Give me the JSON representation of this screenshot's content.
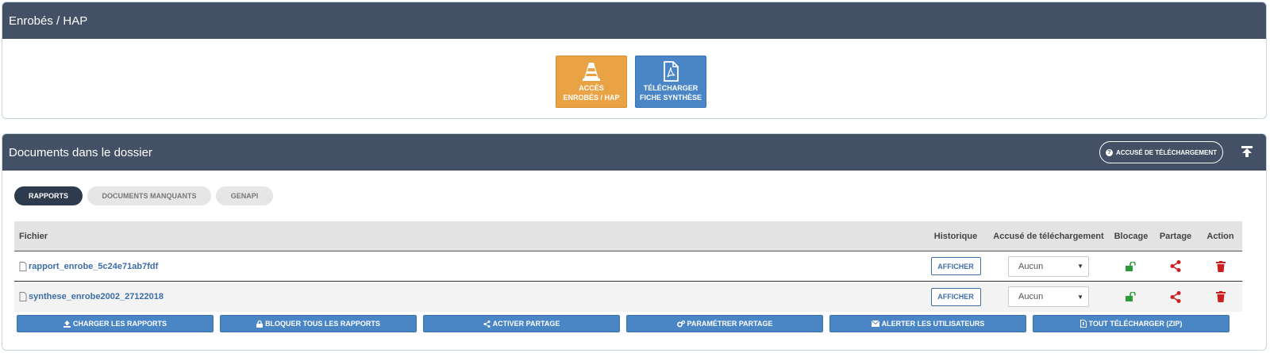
{
  "top_panel": {
    "title": "Enrobés / HAP",
    "tiles": [
      {
        "line1": "Accès",
        "line2": "enrobés / HAP",
        "icon": "traffic-cone-icon",
        "color": "#e9a345"
      },
      {
        "line1": "Télécharger",
        "line2": "fiche synthèse",
        "icon": "pdf-file-icon",
        "color": "#4a86c6"
      }
    ]
  },
  "docs_panel": {
    "title": "Documents dans le dossier",
    "accuse_button": "Accusé de téléchargement",
    "tabs": [
      {
        "label": "Rapports",
        "active": true
      },
      {
        "label": "Documents manquants",
        "active": false
      },
      {
        "label": "GENAPI",
        "active": false
      }
    ],
    "table": {
      "headers": [
        "Fichier",
        "Historique",
        "Accusé de téléchargement",
        "Blocage",
        "Partage",
        "Action"
      ],
      "rows": [
        {
          "file": "rapport_enrobe_5c24e71ab7fdf",
          "history_button": "Afficher",
          "accuse": "Aucun",
          "blocage_icon": "unlock-icon",
          "partage_icon": "share-icon",
          "action_icon": "trash-icon"
        },
        {
          "file": "synthese_enrobe2002_27122018",
          "history_button": "Afficher",
          "accuse": "Aucun",
          "blocage_icon": "unlock-icon",
          "partage_icon": "share-icon",
          "action_icon": "trash-icon"
        }
      ]
    },
    "action_buttons": [
      {
        "label": "Charger les rapports",
        "icon": "upload-icon"
      },
      {
        "label": "Bloquer tous les rapports",
        "icon": "lock-icon"
      },
      {
        "label": "Activer partage",
        "icon": "share-icon"
      },
      {
        "label": "Paramétrer partage",
        "icon": "gears-icon"
      },
      {
        "label": "Alerter les utilisateurs",
        "icon": "envelope-icon"
      },
      {
        "label": "Tout télécharger (ZIP)",
        "icon": "file-zip-icon"
      }
    ]
  },
  "colors": {
    "header_bg": "#435066",
    "accent_blue": "#4a86c6",
    "accent_orange": "#e9a345",
    "link_blue": "#3d6ea8",
    "danger_red": "#cc1f1f",
    "success_green": "#2f9a3a"
  }
}
